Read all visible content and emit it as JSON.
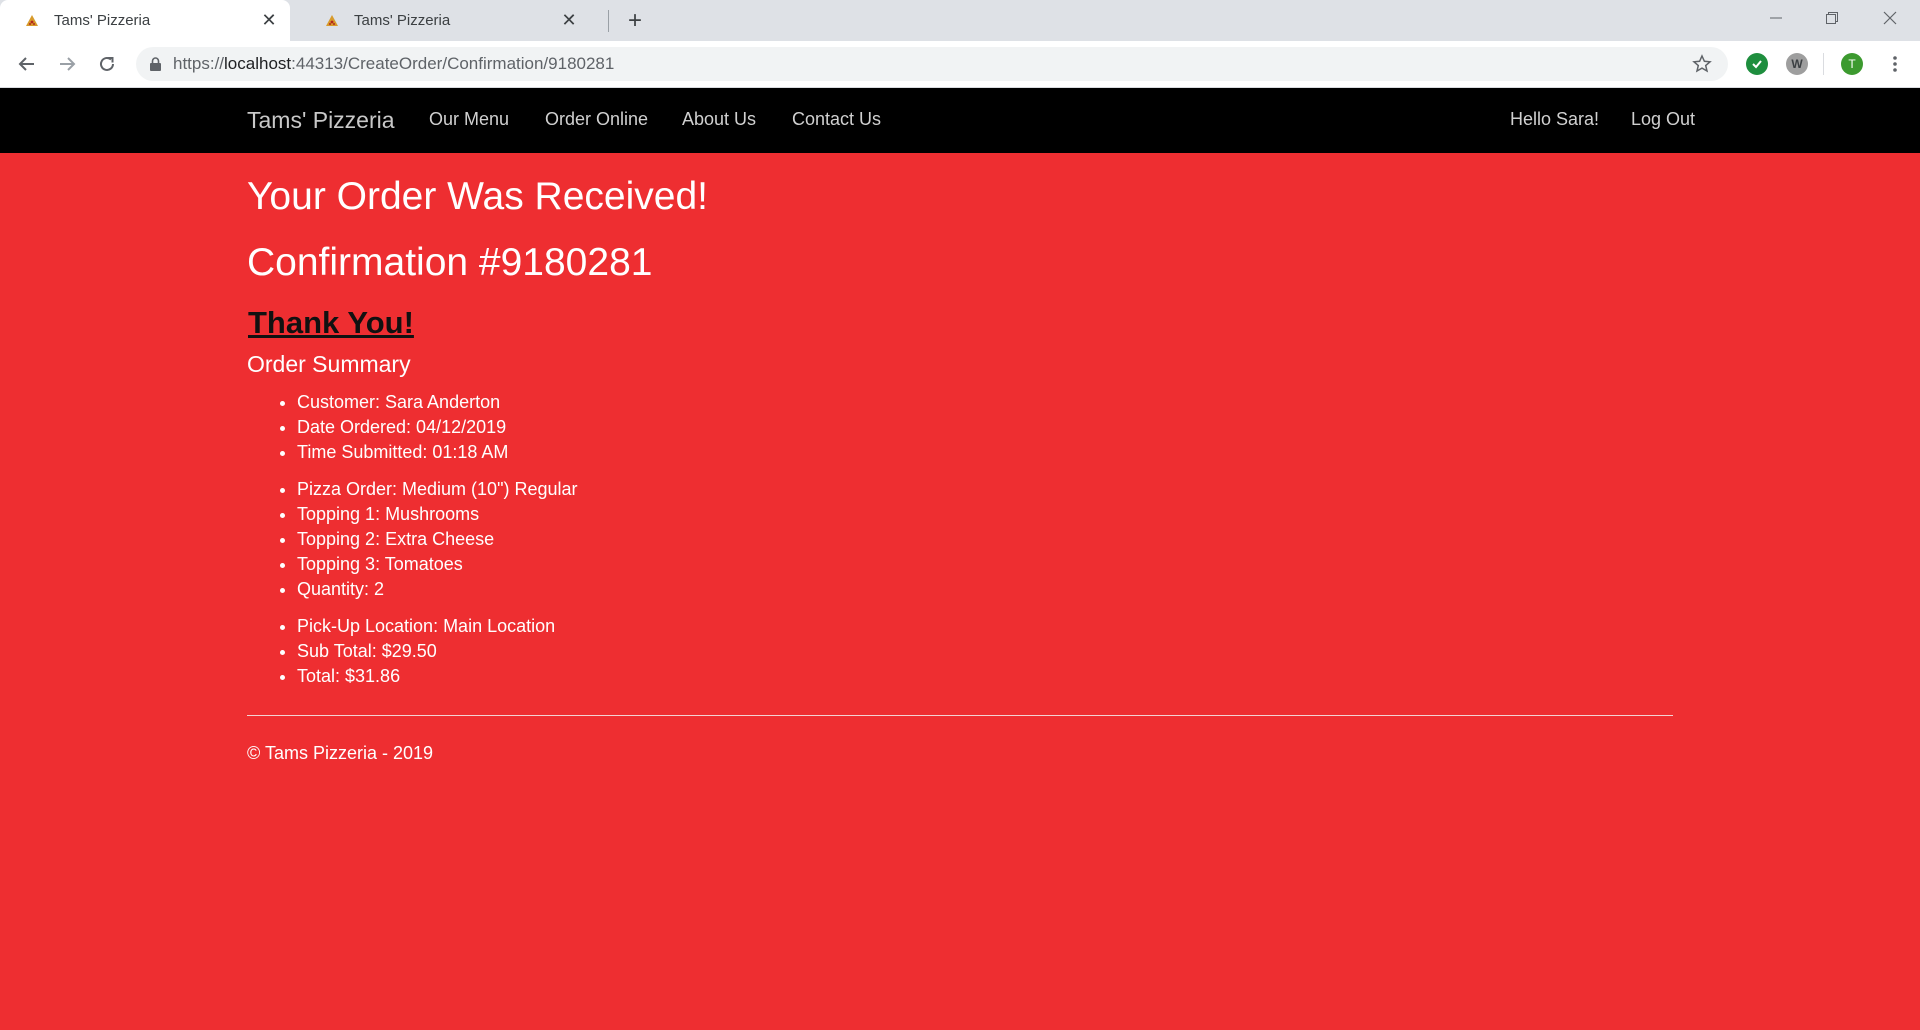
{
  "browser": {
    "tabs": [
      {
        "title": "Tams' Pizzeria",
        "active": true
      },
      {
        "title": "Tams' Pizzeria",
        "active": false
      }
    ],
    "url_prefix": "https://",
    "url_host": "localhost",
    "url_path": ":44313/CreateOrder/Confirmation/9180281",
    "profile_initial": "T",
    "extension_w_label": "W"
  },
  "navbar": {
    "brand": "Tams' Pizzeria",
    "links": [
      "Our Menu",
      "Order Online",
      "About Us",
      "Contact Us"
    ],
    "greeting": "Hello Sara!",
    "logout": "Log Out"
  },
  "page": {
    "heading": "Your Order Was Received!",
    "confirmation": "Confirmation #9180281",
    "thanks": "Thank You!",
    "summary_title": "Order Summary",
    "customer_info": [
      "Customer: Sara Anderton",
      "Date Ordered: 04/12/2019",
      "Time Submitted: 01:18 AM"
    ],
    "pizza_info": [
      "Pizza Order: Medium (10\") Regular",
      "Topping 1: Mushrooms",
      "Topping 2: Extra Cheese",
      "Topping 3: Tomatoes",
      "Quantity: 2"
    ],
    "payment_info": [
      "Pick-Up Location: Main Location",
      "Sub Total: $29.50",
      "Total: $31.86"
    ],
    "footer": "© Tams Pizzeria - 2019"
  },
  "colors": {
    "page_background": "#ee2e31",
    "navbar_background": "#000000",
    "profile_avatar": "#3c9a2f",
    "extension_check": "#1e8e3e"
  }
}
